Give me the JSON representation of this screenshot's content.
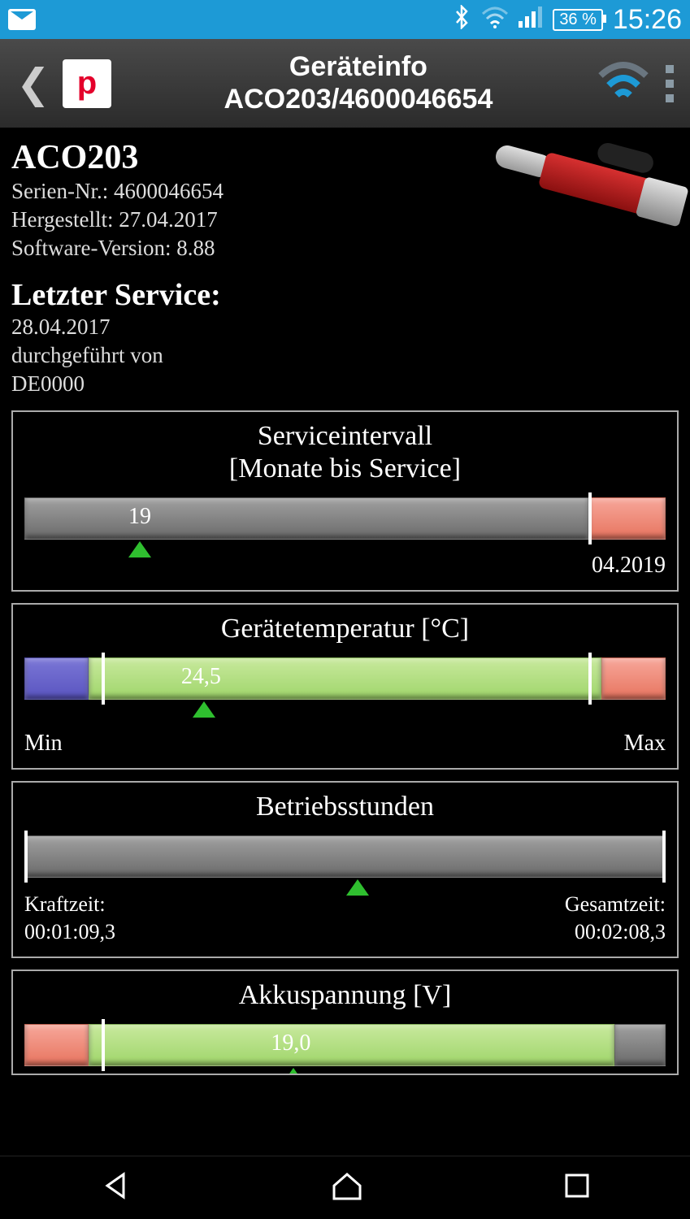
{
  "status": {
    "battery": "36 %",
    "time": "15:26"
  },
  "header": {
    "title1": "Geräteinfo",
    "title2": "ACO203/4600046654"
  },
  "device": {
    "name": "ACO203",
    "serial_label": "Serien-Nr.:",
    "serial": "4600046654",
    "manufactured_label": "Hergestellt:",
    "manufactured": "27.04.2017",
    "software_label": "Software-Version:",
    "software": "8.88"
  },
  "service": {
    "heading": "Letzter Service:",
    "date": "28.04.2017",
    "by_label": "durchgeführt von",
    "by": "DE0000"
  },
  "panels": {
    "interval": {
      "title_line1": "Serviceintervall",
      "title_line2": "[Monate bis Service]",
      "value": "19",
      "end_label": "04.2019",
      "marker_pct": 18,
      "gray_pct": 88,
      "red_pct": 12
    },
    "temp": {
      "title": "Gerätetemperatur [°C]",
      "value": "24,5",
      "min": "Min",
      "max": "Max",
      "marker_pct": 28,
      "blue_pct": 10,
      "green_pct": 80,
      "red_pct": 10,
      "tick_low_pct": 12,
      "tick_high_pct": 88
    },
    "hours": {
      "title": "Betriebsstunden",
      "kraft_label": "Kraftzeit:",
      "kraft_val": "00:01:09,3",
      "gesamt_label": "Gesamtzeit:",
      "gesamt_val": "00:02:08,3",
      "marker_pct": 52
    },
    "batt": {
      "title": "Akkuspannung [V]",
      "value": "19,0",
      "marker_pct": 42,
      "red_pct": 10,
      "green_pct": 82,
      "tail_pct": 8,
      "tick_low_pct": 12
    }
  }
}
